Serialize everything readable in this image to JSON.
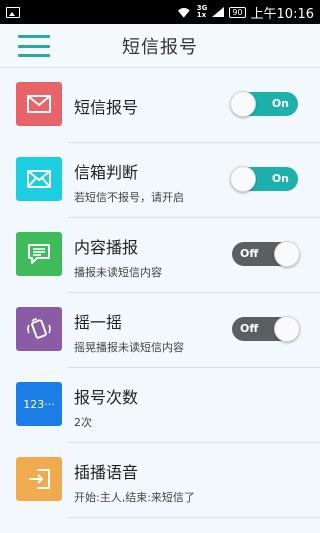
{
  "status_bar": {
    "network_top": "3G",
    "network_bottom": "1x",
    "battery": "90",
    "time": "上午10:16"
  },
  "header": {
    "title": "短信报号"
  },
  "rows": [
    {
      "label": "短信报号",
      "sub": "",
      "icon": "envelope-icon",
      "color": "#e8646a",
      "toggle": "On"
    },
    {
      "label": "信箱判断",
      "sub": "若短信不报号，请开启",
      "icon": "mailbox-icon",
      "color": "#1ccfe0",
      "toggle": "On"
    },
    {
      "label": "内容播报",
      "sub": "播报未读短信内容",
      "icon": "message-bubble-icon",
      "color": "#3fbb5c",
      "toggle": "Off"
    },
    {
      "label": "摇一摇",
      "sub": "摇晃播报未读短信内容",
      "icon": "shake-phone-icon",
      "color": "#8b5ca6",
      "toggle": "Off"
    },
    {
      "label": "报号次数",
      "sub": "2次",
      "icon": "number-icon",
      "icon_text": "123···",
      "color": "#1b7ee6",
      "toggle": ""
    },
    {
      "label": "插播语音",
      "sub": "开始:主人,结束:来短信了",
      "icon": "login-arrow-icon",
      "color": "#f0ab50",
      "toggle": ""
    }
  ]
}
